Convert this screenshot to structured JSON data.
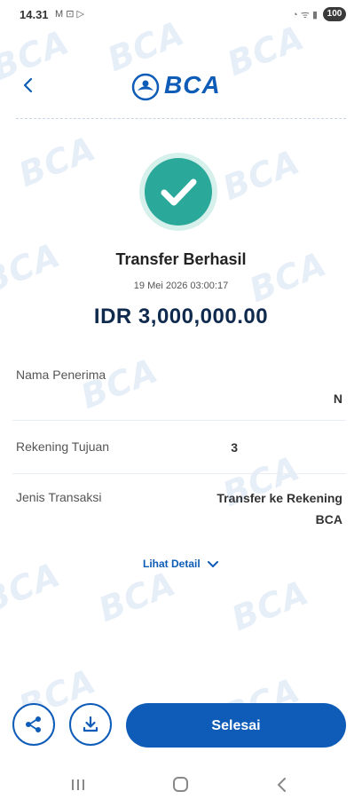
{
  "status_bar": {
    "time": "14.31",
    "left_icons": "M ⊡ ▷",
    "right_icons": "◔ ᯤ ▮",
    "battery": "100"
  },
  "header": {
    "back_icon": "chevron-left-icon",
    "logo_text": "BCA",
    "brand_color": "#0e5cb7"
  },
  "result": {
    "title": "Transfer Berhasil",
    "datetime": "19 Mei 2026 03:00:17",
    "amount": "IDR 3,000,000.00",
    "success_color": "#2aa89a"
  },
  "details": [
    {
      "label": "Nama Penerima",
      "value_line1": "",
      "value_line2": "N"
    },
    {
      "label": "Rekening Tujuan",
      "value_line1": "3",
      "value_line2": ""
    },
    {
      "label": "Jenis Transaksi",
      "value_line1": "Transfer ke Rekening",
      "value_line2": "BCA"
    }
  ],
  "detail_link": {
    "label": "Lihat Detail"
  },
  "actions": {
    "share_icon": "share-icon",
    "download_icon": "download-icon",
    "done_label": "Selesai"
  },
  "watermark_text": "BCA",
  "nav": {
    "recents_icon": "recents-icon",
    "home_icon": "home-icon",
    "back_icon": "back-icon"
  }
}
